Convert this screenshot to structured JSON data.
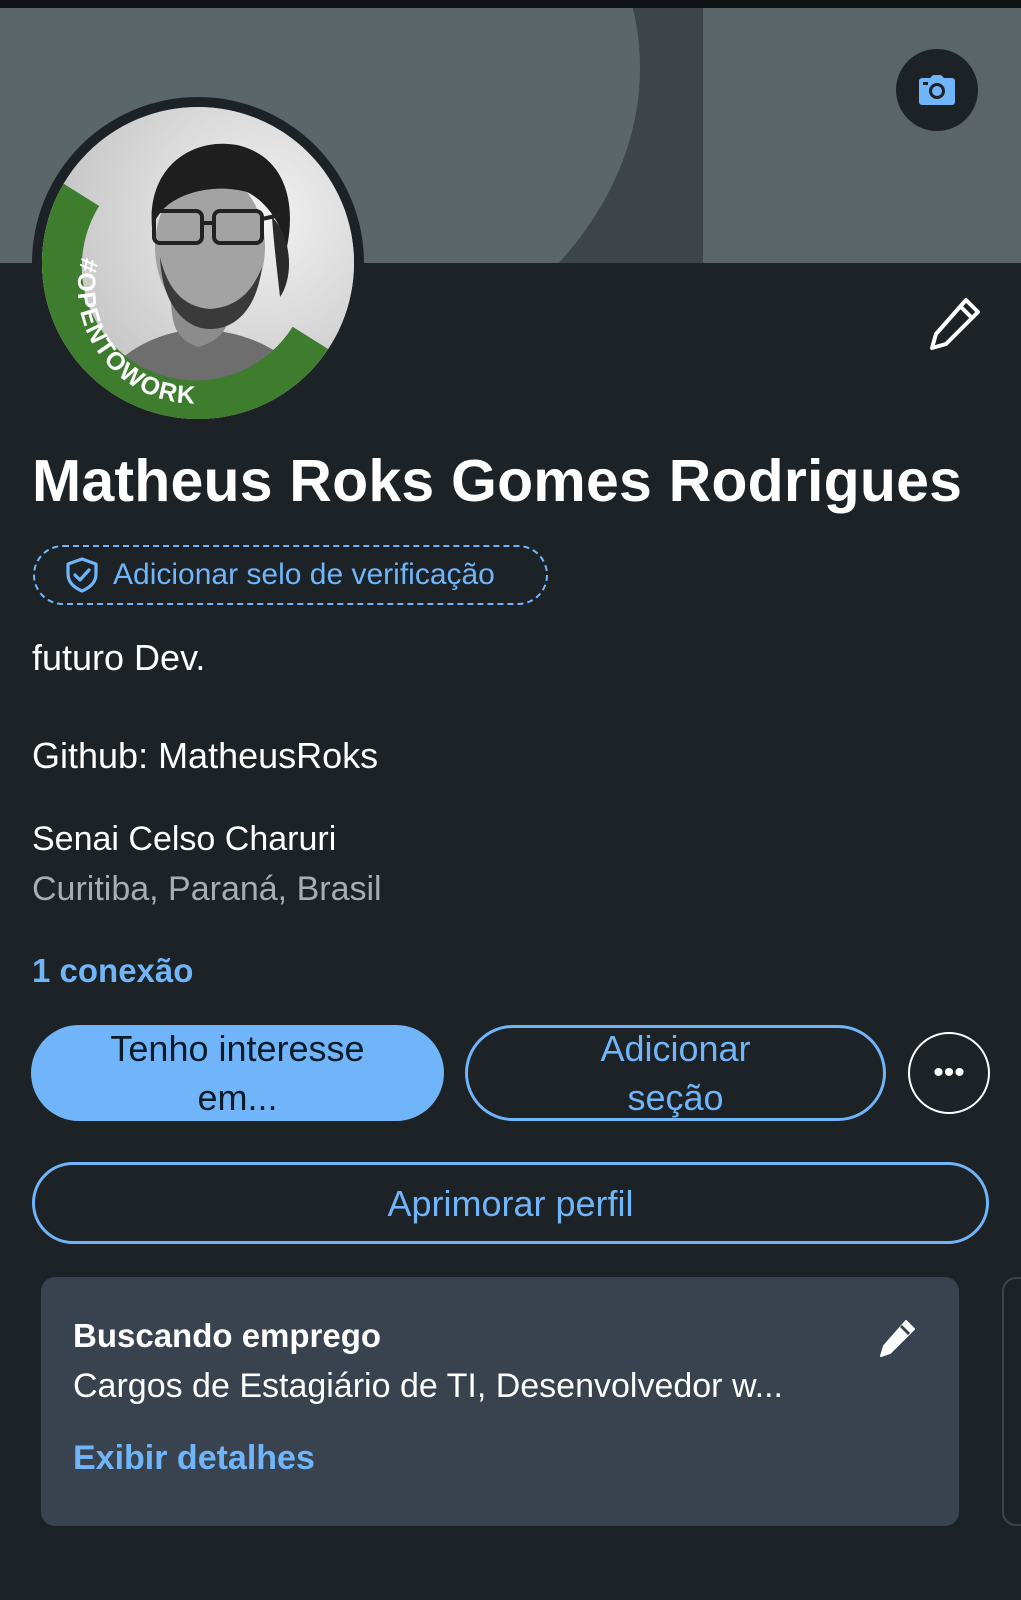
{
  "profile": {
    "name": "Matheus Roks Gomes Rodrigues",
    "verify_label": "Adicionar selo de verificação",
    "headline_line1": "futuro Dev.",
    "headline_line2": "Github: MatheusRoks",
    "school": "Senai Celso Charuri",
    "location": "Curitiba, Paraná, Brasil",
    "connections": "1 conexão",
    "badge_text": "#OPENTOWORK"
  },
  "actions": {
    "primary_label": "Tenho interesse em...",
    "add_section_label": "Adicionar seção",
    "more_label": "•••",
    "improve_label": "Aprimorar perfil"
  },
  "open_to_work_card": {
    "title": "Buscando emprego",
    "subtitle": "Cargos de Estagiário de TI, Desenvolvedor w...",
    "link": "Exibir detalhes"
  },
  "icons": {
    "camera": "camera-icon",
    "edit": "pencil-icon",
    "shield": "shield-check-icon",
    "more": "more-horizontal-icon"
  },
  "colors": {
    "background": "#1d2226",
    "accent": "#70b5f9",
    "card": "#38434f",
    "open_to_work_green": "#3f7d2e"
  }
}
